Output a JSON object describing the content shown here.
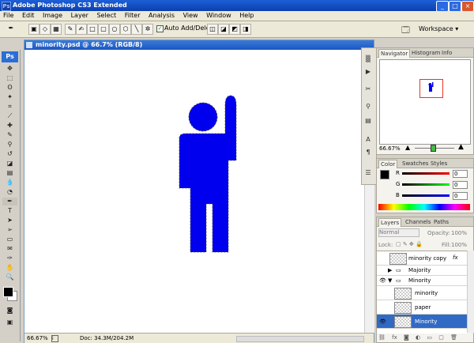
{
  "window": {
    "title": "Adobe Photoshop CS3 Extended",
    "minimize": "_",
    "maximize": "□",
    "close": "×"
  },
  "menu": [
    "File",
    "Edit",
    "Image",
    "Layer",
    "Select",
    "Filter",
    "Analysis",
    "View",
    "Window",
    "Help"
  ],
  "options": {
    "auto_add_delete": "Auto Add/Delete",
    "workspace": "Workspace ▾"
  },
  "toolbox": {
    "logo": "Ps"
  },
  "document": {
    "title": "minority.psd @ 66.7% (RGB/8)",
    "zoom": "66.67%",
    "doc_info": "Doc: 34.3M/204.2M"
  },
  "navigator": {
    "tabs": [
      "Navigator",
      "Histogram",
      "Info"
    ],
    "zoom": "66.67%"
  },
  "color": {
    "tabs": [
      "Color",
      "Swatches",
      "Styles"
    ],
    "r_label": "R",
    "g_label": "G",
    "b_label": "B",
    "r": "0",
    "g": "0",
    "b": "0"
  },
  "layers": {
    "tabs": [
      "Layers",
      "Channels",
      "Paths"
    ],
    "mode": "Normal",
    "opacity_label": "Opacity:",
    "opacity": "100%",
    "lock_label": "Lock:",
    "fill_label": "Fill:",
    "fill": "100%",
    "rows": [
      "minority copy",
      "Majority",
      "Minority",
      "minority",
      "paper",
      "Minority"
    ],
    "fx": "fx"
  },
  "colors": {
    "figure": "#0000ee",
    "outline": "#ff0000"
  }
}
